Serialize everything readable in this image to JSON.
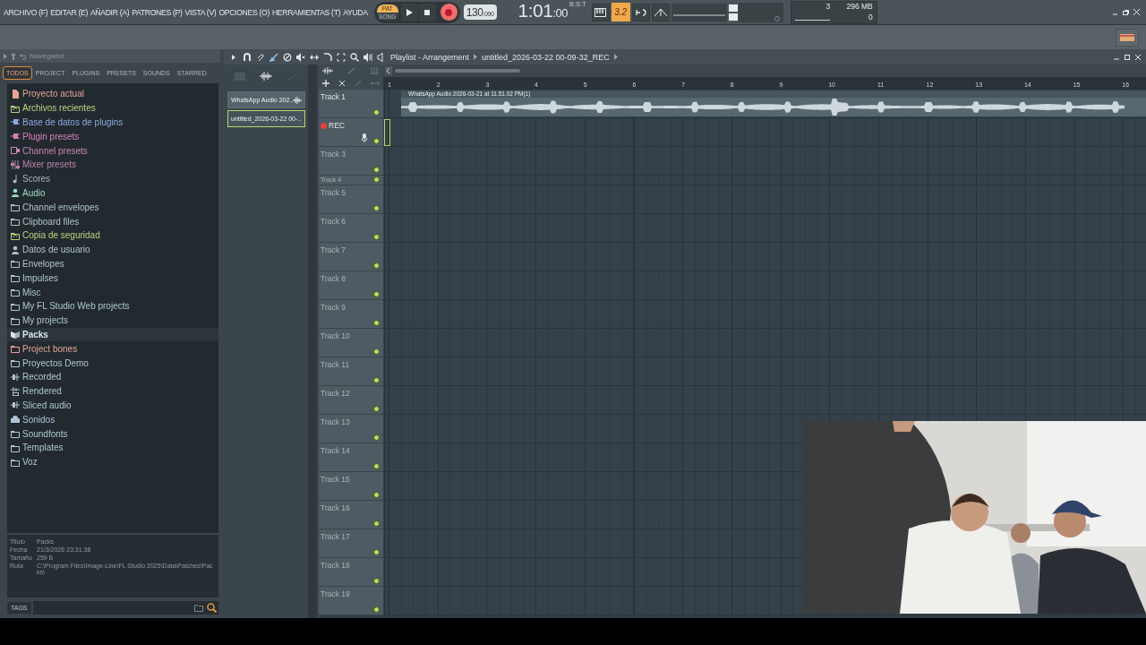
{
  "menu": [
    "ARCHIVO (F)",
    "EDITAR (E)",
    "AÑADIR (A)",
    "PATRONES (P)",
    "VISTA (V)",
    "OPCIONES (O)",
    "HERRAMIENTAS (T)",
    "AYUDA"
  ],
  "transport": {
    "modes": [
      {
        "label": "PAT",
        "selected": true
      },
      {
        "label": "SONG",
        "selected": false
      }
    ],
    "recording": true,
    "tempo": "130",
    "tempo_fraction": ".000"
  },
  "time": {
    "value": "1:01",
    "sub": ":00",
    "format": "B:S:T"
  },
  "snap_label": "3.2",
  "monitor": {
    "cpu": "3",
    "memory": "296 MB",
    "polyphony": "0"
  },
  "browser": {
    "title": "Navegador",
    "tabs": [
      {
        "label": "TODOS",
        "selected": true
      },
      {
        "label": "PROJECT",
        "selected": false
      },
      {
        "label": "PLUGINS",
        "selected": false
      },
      {
        "label": "PRESETS",
        "selected": false
      },
      {
        "label": "SOUNDS",
        "selected": false
      },
      {
        "label": "STARRED",
        "selected": false
      }
    ],
    "items": [
      {
        "label": "Proyecto actual",
        "kind": "file",
        "color": "#e3a392",
        "selected": false
      },
      {
        "label": "Archivos recientes",
        "kind": "recent",
        "color": "#b8d47c",
        "selected": false
      },
      {
        "label": "Base de datos de plugins",
        "kind": "plugin",
        "color": "#8ea8e0",
        "selected": false
      },
      {
        "label": "Plugin presets",
        "kind": "plugin",
        "color": "#d682b8",
        "selected": false
      },
      {
        "label": "Channel presets",
        "kind": "channel",
        "color": "#c985b2",
        "selected": false
      },
      {
        "label": "Mixer presets",
        "kind": "mixer",
        "color": "#b985aa",
        "selected": false
      },
      {
        "label": "Scores",
        "kind": "note",
        "color": "#a8b3b8",
        "selected": false
      },
      {
        "label": "Audio",
        "kind": "user",
        "color": "#9fd6bd",
        "selected": false
      },
      {
        "label": "Channel envelopes",
        "kind": "folder",
        "color": "#aec3c4",
        "selected": false
      },
      {
        "label": "Clipboard files",
        "kind": "folder",
        "color": "#aec3c4",
        "selected": false
      },
      {
        "label": "Copia de seguridad",
        "kind": "recent",
        "color": "#b8d47c",
        "selected": false
      },
      {
        "label": "Datos de usuario",
        "kind": "user",
        "color": "#aec3c4",
        "selected": false
      },
      {
        "label": "Envelopes",
        "kind": "folder",
        "color": "#aec3c4",
        "selected": false
      },
      {
        "label": "Impulses",
        "kind": "folder",
        "color": "#aec8c4",
        "selected": false
      },
      {
        "label": "Misc",
        "kind": "folder",
        "color": "#aec8c4",
        "selected": false
      },
      {
        "label": "My FL Studio Web projects",
        "kind": "folder",
        "color": "#aec8c4",
        "selected": false
      },
      {
        "label": "My projects",
        "kind": "folder",
        "color": "#aec8c4",
        "selected": false
      },
      {
        "label": "Packs",
        "kind": "packs",
        "color": "#d6e4ee",
        "selected": true
      },
      {
        "label": "Project bones",
        "kind": "folder",
        "color": "#e3a392",
        "selected": false
      },
      {
        "label": "Proyectos Demo",
        "kind": "folder",
        "color": "#aec8c4",
        "selected": false
      },
      {
        "label": "Recorded",
        "kind": "wave",
        "color": "#aec8c4",
        "selected": false
      },
      {
        "label": "Rendered",
        "kind": "rendered",
        "color": "#aec8c4",
        "selected": false
      },
      {
        "label": "Sliced audio",
        "kind": "wave",
        "color": "#aec8c4",
        "selected": false
      },
      {
        "label": "Sonidos",
        "kind": "cloud",
        "color": "#aec3d8",
        "selected": false
      },
      {
        "label": "Soundfonts",
        "kind": "folder",
        "color": "#aec8c4",
        "selected": false
      },
      {
        "label": "Templates",
        "kind": "folder",
        "color": "#aec8c4",
        "selected": false
      },
      {
        "label": "Voz",
        "kind": "folder",
        "color": "#aec8c4",
        "selected": false
      }
    ],
    "info": [
      {
        "key": "Titulo",
        "value": "Packs"
      },
      {
        "key": "Fecha",
        "value": "21/3/2026 23:31:38"
      },
      {
        "key": "Tamaño",
        "value": "259 B"
      },
      {
        "key": "Ruta",
        "value": "C:\\Program Files\\Image-Line\\FL Studio 2025\\Data\\Patches\\Packs\\"
      }
    ],
    "tags_label": "TAGS"
  },
  "playlist": {
    "title": "Playlist - Arrangement",
    "project": "untitled_2026-03-22 00-09-32_REC",
    "clips": [
      {
        "label": "WhatsApp Audio 202..",
        "has_icon": true,
        "selected": false
      },
      {
        "label": "untitled_2026-03-22 00-..",
        "has_icon": false,
        "selected": true
      }
    ],
    "ruler": [
      "1",
      "2",
      "3",
      "4",
      "5",
      "6",
      "7",
      "8",
      "9",
      "10",
      "11",
      "12",
      "13",
      "14",
      "15",
      "16"
    ],
    "tracks": [
      {
        "name": "Track 1",
        "kind": "normal",
        "dimmed": false,
        "armed": false,
        "clip": "WhatsApp Audio 2026-03-21 at 11.51.02 PM(1)"
      },
      {
        "name": "REC",
        "kind": "normal",
        "dimmed": false,
        "armed": true
      },
      {
        "name": "Track 3",
        "kind": "normal",
        "dimmed": true,
        "armed": false
      },
      {
        "name": "Track 4",
        "kind": "small",
        "dimmed": true,
        "armed": false
      },
      {
        "name": "Track 5",
        "kind": "normal",
        "dimmed": true,
        "armed": false
      },
      {
        "name": "Track 6",
        "kind": "normal",
        "dimmed": true,
        "armed": false
      },
      {
        "name": "Track 7",
        "kind": "normal",
        "dimmed": true,
        "armed": false
      },
      {
        "name": "Track 8",
        "kind": "normal",
        "dimmed": true,
        "armed": false
      },
      {
        "name": "Track 9",
        "kind": "normal",
        "dimmed": true,
        "armed": false
      },
      {
        "name": "Track 10",
        "kind": "normal",
        "dimmed": true,
        "armed": false
      },
      {
        "name": "Track 11",
        "kind": "normal",
        "dimmed": true,
        "armed": false
      },
      {
        "name": "Track 12",
        "kind": "normal",
        "dimmed": true,
        "armed": false
      },
      {
        "name": "Track 13",
        "kind": "normal",
        "dimmed": true,
        "armed": false
      },
      {
        "name": "Track 14",
        "kind": "normal",
        "dimmed": true,
        "armed": false
      },
      {
        "name": "Track 15",
        "kind": "normal",
        "dimmed": true,
        "armed": false
      },
      {
        "name": "Track 16",
        "kind": "normal",
        "dimmed": true,
        "armed": false
      },
      {
        "name": "Track 17",
        "kind": "normal",
        "dimmed": true,
        "armed": false
      },
      {
        "name": "Track 18",
        "kind": "normal",
        "dimmed": true,
        "armed": false
      },
      {
        "name": "Track 19",
        "kind": "normal",
        "dimmed": true,
        "armed": false
      }
    ]
  }
}
